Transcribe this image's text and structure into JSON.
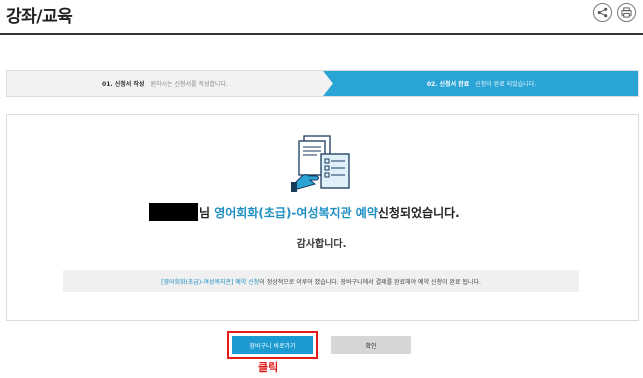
{
  "page": {
    "title": "강좌/교육",
    "share_icon": "share-icon",
    "print_icon": "print-icon"
  },
  "steps": [
    {
      "number": "01. 신청서 작성",
      "desc": "원하시는 신청서를 작성합니다.",
      "active": false
    },
    {
      "number": "02. 신청서 완료",
      "desc": "신청이 완료 되었습니다.",
      "active": true
    }
  ],
  "result": {
    "illustration_icon": "application-document-icon",
    "name_suffix": "님 ",
    "course_name": "영어회화(초급)-여성복지관 예약",
    "status_text": "신청되었습니다.",
    "thanks": "감사합니다.",
    "notice_course": "[영어회화(초급)-여성복지관] 예약 신청",
    "notice_text": "이 정상적으로 이루어 졌습니다. 장바구니에서 결제를 완료해야 예약 신청이 완료 됩니다."
  },
  "buttons": {
    "cart_label": "장바구니 바로가기",
    "confirm_label": "확인"
  },
  "annotation": {
    "click_label": "클릭"
  },
  "colors": {
    "accent": "#1d9bd1",
    "highlight": "#e21b1b"
  }
}
